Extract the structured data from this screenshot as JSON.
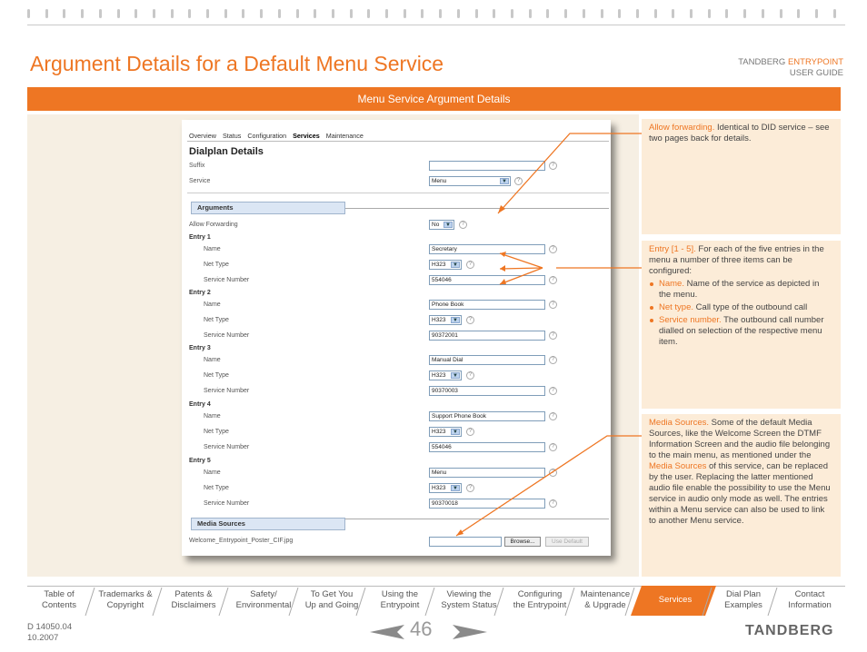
{
  "header": {
    "title": "Argument Details for a Default Menu Service",
    "brand_prefix": "TANDBERG",
    "brand_product": "ENTRYPOINT",
    "brand_sub": "USER GUIDE"
  },
  "banner": {
    "text": "Menu Service Argument Details"
  },
  "screenshot": {
    "nav": [
      "Overview",
      "Status",
      "Configuration",
      "Services",
      "Maintenance"
    ],
    "nav_active": "Services",
    "page_title": "Dialplan Details",
    "suffix_label": "Suffix",
    "service_label": "Service",
    "service_value": "Menu",
    "arguments_title": "Arguments",
    "allow_forwarding_label": "Allow Forwarding",
    "allow_forwarding_value": "No",
    "field_labels": {
      "name": "Name",
      "net_type": "Net Type",
      "service_number": "Service Number"
    },
    "entries": [
      {
        "title": "Entry 1",
        "name": "Secretary",
        "net_type": "H323",
        "service_number": "554046"
      },
      {
        "title": "Entry 2",
        "name": "Phone Book",
        "net_type": "H323",
        "service_number": "90372001"
      },
      {
        "title": "Entry 3",
        "name": "Manual Dial",
        "net_type": "H323",
        "service_number": "90370003"
      },
      {
        "title": "Entry 4",
        "name": "Support Phone Book",
        "net_type": "H323",
        "service_number": "554046"
      },
      {
        "title": "Entry 5",
        "name": "Menu",
        "net_type": "H323",
        "service_number": "90370018"
      }
    ],
    "media_title": "Media Sources",
    "media_file_label": "Welcome_Entrypoint_Poster_CIF.jpg",
    "browse_label": "Browse...",
    "use_default_label": "Use Default",
    "help_glyph": "?"
  },
  "notes": {
    "forwarding": {
      "head": "Allow forwarding.",
      "text": " Identical to DID service – see two pages back for details."
    },
    "entries": {
      "head": "Entry [1 - 5].",
      "text": " For each of the five entries in the menu a number of three items can be configured:",
      "bullets": [
        {
          "head": "Name.",
          "text": " Name of the service as depicted in the menu."
        },
        {
          "head": "Net type.",
          "text": " Call type of the outbound call"
        },
        {
          "head": "Service number.",
          "text": " The outbound call number dialled on selection of the respective menu item."
        }
      ]
    },
    "media": {
      "head": "Media Sources.",
      "text1": " Some of the default Media Sources, like the Welcome Screen the DTMF Information Screen and the audio file belonging to the main menu, as mentioned under the ",
      "link": "Media Sources",
      "text2": " of this service, can be replaced by the user. Replacing the latter mentioned audio file enable the possibility to use the Menu service in audio only mode as well. The entries within a Menu service can also be used to link to another Menu service."
    }
  },
  "tabs": [
    {
      "line1": "Table of",
      "line2": "Contents"
    },
    {
      "line1": "Trademarks &",
      "line2": "Copyright"
    },
    {
      "line1": "Patents &",
      "line2": "Disclaimers"
    },
    {
      "line1": "Safety/",
      "line2": "Environmental"
    },
    {
      "line1": "To Get You",
      "line2": "Up and Going"
    },
    {
      "line1": "Using the",
      "line2": "Entrypoint"
    },
    {
      "line1": "Viewing the",
      "line2": "System Status"
    },
    {
      "line1": "Configuring",
      "line2": "the Entrypoint"
    },
    {
      "line1": "Maintenance",
      "line2": "& Upgrade"
    },
    {
      "line1": "Services",
      "line2": ""
    },
    {
      "line1": "Dial Plan",
      "line2": "Examples"
    },
    {
      "line1": "Contact",
      "line2": "Information"
    }
  ],
  "active_tab": "Services",
  "footer": {
    "doc_id": "D 14050.04",
    "date": "10.2007",
    "page_number": "46",
    "logo": "TANDBERG"
  },
  "colors": {
    "accent": "#ee7623",
    "panel": "#f6efe3",
    "note_bg": "#fcecd8"
  }
}
